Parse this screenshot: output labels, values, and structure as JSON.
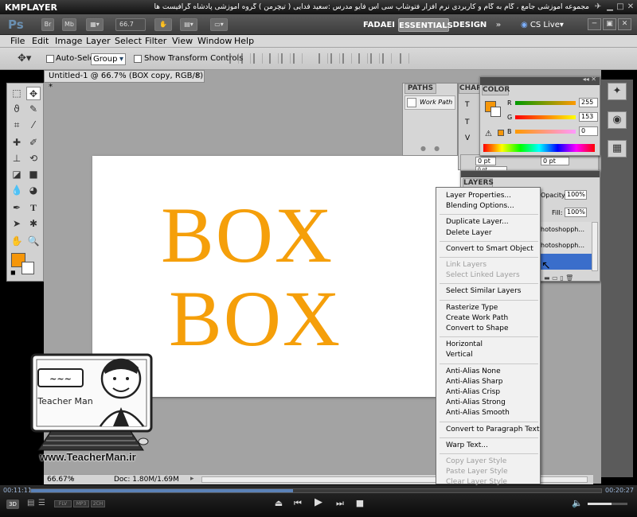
{
  "player": {
    "logo": "KMPLAYER",
    "caption": "مجموعه آموزشی جامع ، گام به گام و کاربردی نرم افزار فتوشاپ سی اس فایو  مدرس :سعید فدایی ( تیچرمن ) گروه آموزشی پادشاه گرافیست ها",
    "time_elapsed": "00:11:11",
    "time_total": "00:20:27",
    "progress": 0.46,
    "badges": [
      "3D",
      "FLV",
      "MP3",
      "2CH"
    ]
  },
  "ps": {
    "logo": "Ps",
    "zoom_field": "66.7",
    "workspaces": [
      "FADAEI",
      "ESSENTIALS",
      "DESIGN"
    ],
    "cs_live": "CS Live",
    "menu": [
      "File",
      "Edit",
      "Image",
      "Layer",
      "Select",
      "Filter",
      "View",
      "Window",
      "Help"
    ],
    "options": {
      "auto_select_label": "Auto-Select:",
      "auto_select_value": "Group",
      "show_transform_label": "Show Transform Controls"
    },
    "document": {
      "tab_title": "Untitled-1 @ 66.7% (BOX copy, RGB/8) *",
      "text_line1": "BOX",
      "text_line2": "BOX",
      "zoom_status": "66.67%",
      "doc_status": "Doc: 1.80M/1.69M"
    },
    "colors": {
      "text_orange": "#f59f0a",
      "foreground": "#f5960a"
    },
    "paths_panel": {
      "tab": "PATHS",
      "item": "Work Path"
    },
    "char_tab": "CHAR",
    "color_panel": {
      "tab": "COLOR",
      "r_label": "R",
      "g_label": "G",
      "b_label": "B",
      "r": "255",
      "g": "153",
      "b": "0"
    },
    "char_fields": [
      "0 pt",
      "0 pt",
      "0 pt"
    ],
    "layers_panel": {
      "tab": "LAYERS",
      "opacity_label": "Opacity:",
      "opacity": "100%",
      "fill_label": "Fill:",
      "fill": "100%",
      "rows": [
        "hotoshopph...",
        "hotoshopph..."
      ]
    },
    "context_menu": {
      "groups": [
        [
          {
            "label": "Layer Properties...",
            "enabled": true
          },
          {
            "label": "Blending Options...",
            "enabled": true
          }
        ],
        [
          {
            "label": "Duplicate Layer...",
            "enabled": true
          },
          {
            "label": "Delete Layer",
            "enabled": true
          }
        ],
        [
          {
            "label": "Convert to Smart Object",
            "enabled": true
          }
        ],
        [
          {
            "label": "Link Layers",
            "enabled": false
          },
          {
            "label": "Select Linked Layers",
            "enabled": false
          }
        ],
        [
          {
            "label": "Select Similar Layers",
            "enabled": true
          }
        ],
        [
          {
            "label": "Rasterize Type",
            "enabled": true
          },
          {
            "label": "Create Work Path",
            "enabled": true
          },
          {
            "label": "Convert to Shape",
            "enabled": true
          }
        ],
        [
          {
            "label": "Horizontal",
            "enabled": true
          },
          {
            "label": "Vertical",
            "enabled": true
          }
        ],
        [
          {
            "label": "Anti-Alias None",
            "enabled": true
          },
          {
            "label": "Anti-Alias Sharp",
            "enabled": true
          },
          {
            "label": "Anti-Alias Crisp",
            "enabled": true
          },
          {
            "label": "Anti-Alias Strong",
            "enabled": true
          },
          {
            "label": "Anti-Alias Smooth",
            "enabled": true
          }
        ],
        [
          {
            "label": "Convert to Paragraph Text",
            "enabled": true
          }
        ],
        [
          {
            "label": "Warp Text...",
            "enabled": true
          }
        ],
        [
          {
            "label": "Copy Layer Style",
            "enabled": false
          },
          {
            "label": "Paste Layer Style",
            "enabled": false
          },
          {
            "label": "Clear Layer Style",
            "enabled": false
          }
        ]
      ]
    }
  },
  "watermark": {
    "name": "Teacher Man",
    "url": "www.TeacherMan.ir"
  }
}
